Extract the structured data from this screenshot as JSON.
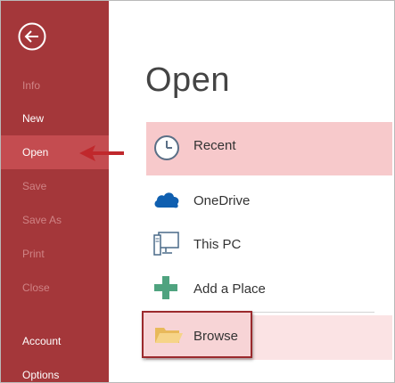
{
  "backstage": {
    "nav": [
      {
        "label": "Info",
        "state": "disabled"
      },
      {
        "label": "New",
        "state": "enabled"
      },
      {
        "label": "Open",
        "state": "selected"
      },
      {
        "label": "Save",
        "state": "disabled"
      },
      {
        "label": "Save As",
        "state": "disabled"
      },
      {
        "label": "Print",
        "state": "disabled"
      },
      {
        "label": "Close",
        "state": "disabled"
      },
      {
        "label": "Account",
        "state": "enabled"
      },
      {
        "label": "Options",
        "state": "enabled"
      }
    ]
  },
  "main": {
    "title": "Open",
    "places": [
      {
        "label": "Recent",
        "icon": "clock-icon"
      },
      {
        "label": "OneDrive",
        "icon": "cloud-icon"
      },
      {
        "label": "This PC",
        "icon": "computer-icon"
      },
      {
        "label": "Add a Place",
        "icon": "plus-icon"
      },
      {
        "label": "Browse",
        "icon": "folder-icon"
      }
    ]
  },
  "colors": {
    "sidebar": "#a4373a",
    "sidebar_selected": "#c44c50",
    "recent_highlight": "#f7c9cb",
    "browse_border": "#9b2a2d",
    "arrow": "#c0282c",
    "onedrive_blue": "#0f5fb0",
    "add_green": "#4fa37f"
  }
}
